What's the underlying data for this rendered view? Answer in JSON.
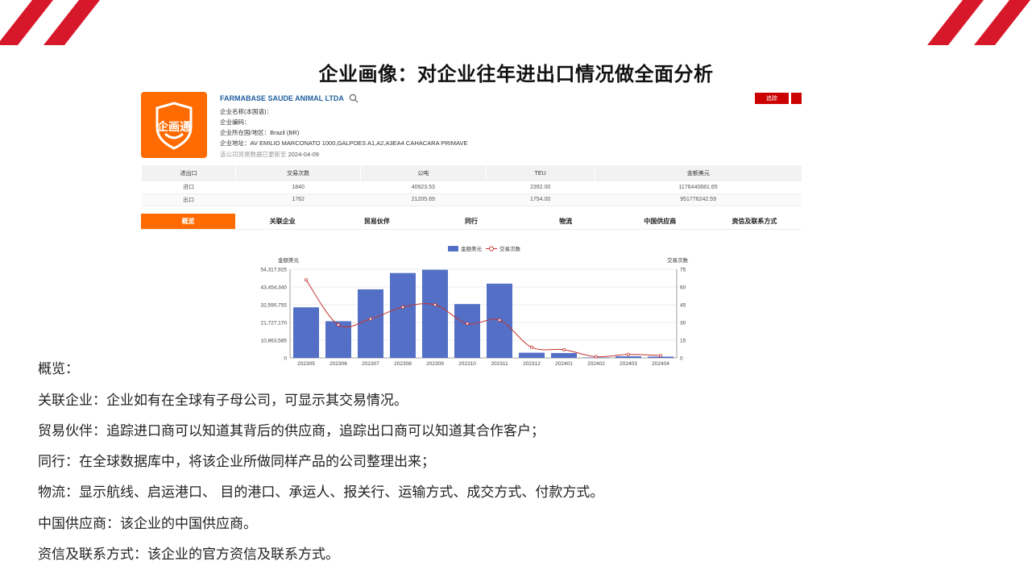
{
  "slide": {
    "title": "企业画像：对企业往年进出口情况做全面分析"
  },
  "company": {
    "logo_text": "企画通",
    "name": "FARMABASE SAUDE ANIMAL LTDA",
    "fields": [
      {
        "label": "企业名称(本国语)：",
        "value": ""
      },
      {
        "label": "企业编码：",
        "value": ""
      },
      {
        "label": "企业所在国/地区：",
        "value": "Brazil (BR)"
      },
      {
        "label": "企业地址：",
        "value": "AV EMILIO MARCONATO 1000,GALPOES A1,A2,A3EA4 CAHACARA PRIMAVE"
      }
    ],
    "update_note": "该公司贸易数据已更新至",
    "update_date": "2024-04-09",
    "track_label": "追踪"
  },
  "summary_table": {
    "headers": [
      "进出口",
      "交易次数",
      "公吨",
      "TEU",
      "金额美元"
    ],
    "rows": [
      [
        "进口",
        "1840",
        "40923.53",
        "2392.00",
        "1176440681.65"
      ],
      [
        "出口",
        "1762",
        "21205.69",
        "1754.00",
        "951776242.59"
      ]
    ]
  },
  "tabs": [
    "概览",
    "关联企业",
    "贸易伙伴",
    "同行",
    "物流",
    "中国供应商",
    "资信及联系方式"
  ],
  "chart_data": {
    "type": "bar",
    "categories": [
      "202305",
      "202306",
      "202307",
      "202308",
      "202309",
      "202310",
      "202311",
      "202312",
      "202401",
      "202402",
      "202403",
      "202404"
    ],
    "series": [
      {
        "name": "金额美元",
        "type": "bar",
        "axis": "left",
        "values": [
          31000000,
          22500000,
          42000000,
          52000000,
          54000000,
          33000000,
          45500000,
          3200000,
          3000000,
          300000,
          1000000,
          800000
        ]
      },
      {
        "name": "交易次数",
        "type": "line",
        "axis": "right",
        "values": [
          66,
          28,
          33,
          43,
          45,
          29,
          32,
          9,
          7,
          1,
          3,
          2
        ]
      }
    ],
    "legend_position": "top-center",
    "ylabel_left": "金额美元",
    "ylabel_right": "交易次数",
    "ylim_left": [
      0,
      54317925
    ],
    "yticks_left": [
      "0",
      "10,863,585",
      "21,727,170",
      "32,590,755",
      "43,454,340",
      "54,317,925"
    ],
    "ylim_right": [
      0,
      75
    ],
    "yticks_right": [
      "0",
      "15",
      "30",
      "45",
      "60",
      "75"
    ],
    "colors": {
      "bar": "#5470c6",
      "line": "#c23531"
    }
  },
  "descriptions": [
    "概览：",
    "关联企业：企业如有在全球有子母公司，可显示其交易情况。",
    "贸易伙伴：追踪进口商可以知道其背后的供应商，追踪出口商可以知道其合作客户；",
    "同行：在全球数据库中，将该企业所做同样产品的公司整理出来；",
    "物流：显示航线、启运港口、 目的港口、承运人、报关行、运输方式、成交方式、付款方式。",
    "中国供应商：该企业的中国供应商。",
    "资信及联系方式：该企业的官方资信及联系方式。"
  ]
}
